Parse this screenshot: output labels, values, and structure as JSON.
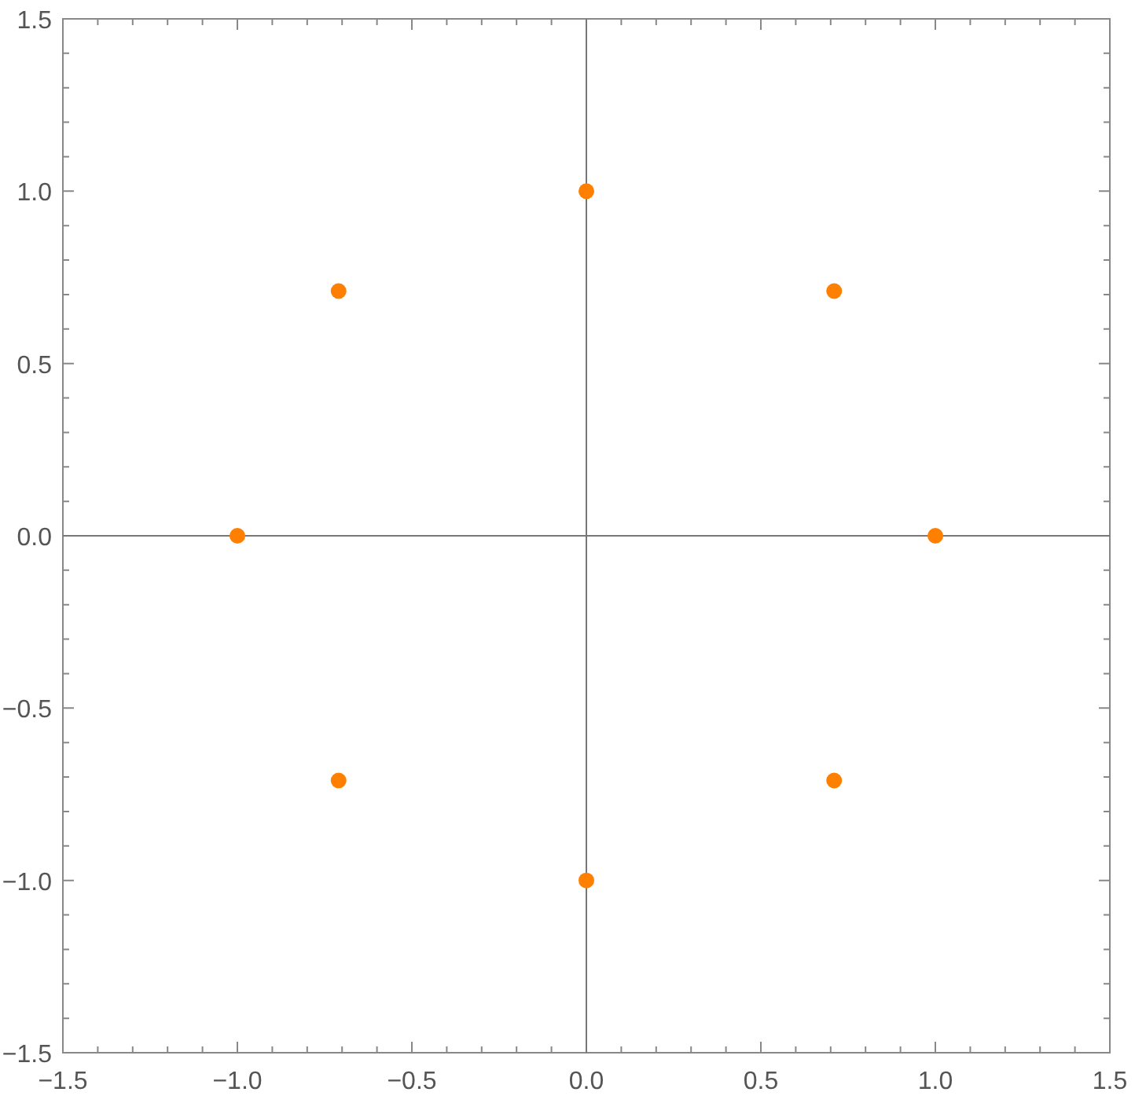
{
  "chart_data": {
    "type": "scatter",
    "x": [
      1,
      0.71,
      0,
      -0.71,
      -1,
      -0.71,
      0,
      0.71
    ],
    "series": [
      {
        "color": "#ff8000",
        "values": [
          0,
          0.71,
          1,
          0.71,
          0,
          -0.71,
          -1,
          -0.71
        ]
      }
    ],
    "xlim": [
      -1.5,
      1.5
    ],
    "ylim": [
      -1.5,
      1.5
    ],
    "xticks": [
      {
        "value": -1.5,
        "label": "−1.5"
      },
      {
        "value": -1,
        "label": "−1.0"
      },
      {
        "value": -0.5,
        "label": "−0.5"
      },
      {
        "value": 0,
        "label": "0.0"
      },
      {
        "value": 0.5,
        "label": "0.5"
      },
      {
        "value": 1,
        "label": "1.0"
      },
      {
        "value": 1.5,
        "label": "1.5"
      }
    ],
    "yticks": [
      {
        "value": -1.5,
        "label": "−1.5"
      },
      {
        "value": -1,
        "label": "−1.0"
      },
      {
        "value": -0.5,
        "label": "−0.5"
      },
      {
        "value": 0,
        "label": "0.0"
      },
      {
        "value": 0.5,
        "label": "0.5"
      },
      {
        "value": 1,
        "label": "1.0"
      },
      {
        "value": 1.5,
        "label": "1.5"
      }
    ]
  }
}
